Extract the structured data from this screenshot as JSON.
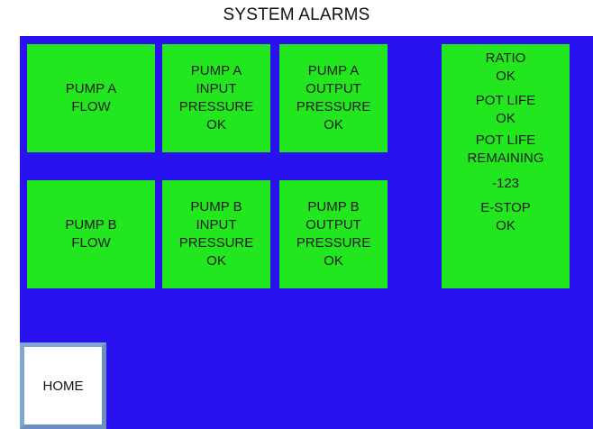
{
  "title": "SYSTEM ALARMS",
  "colors": {
    "panel_background": "#2a12f0",
    "tile_ok": "#22e61e",
    "home_border": "#7ea6d8"
  },
  "tiles": {
    "pump_a_flow": [
      "PUMP A",
      "FLOW"
    ],
    "pump_a_input_pressure": [
      "PUMP A",
      "INPUT",
      "PRESSURE",
      "OK"
    ],
    "pump_a_output_pressure": [
      "PUMP A",
      "OUTPUT",
      "PRESSURE",
      "OK"
    ],
    "pump_b_flow": [
      "PUMP B",
      "FLOW"
    ],
    "pump_b_input_pressure": [
      "PUMP B",
      "INPUT",
      "PRESSURE",
      "OK"
    ],
    "pump_b_output_pressure": [
      "PUMP B",
      "OUTPUT",
      "PRESSURE",
      "OK"
    ]
  },
  "status": {
    "ratio_label": "RATIO",
    "ratio_value": "OK",
    "pot_life_label": "POT LIFE",
    "pot_life_value": "OK",
    "pot_life_remaining_label_1": "POT LIFE",
    "pot_life_remaining_label_2": "REMAINING",
    "pot_life_remaining_value": "-123",
    "estop_label": "E-STOP",
    "estop_value": "OK"
  },
  "home_button": {
    "label": "HOME"
  }
}
